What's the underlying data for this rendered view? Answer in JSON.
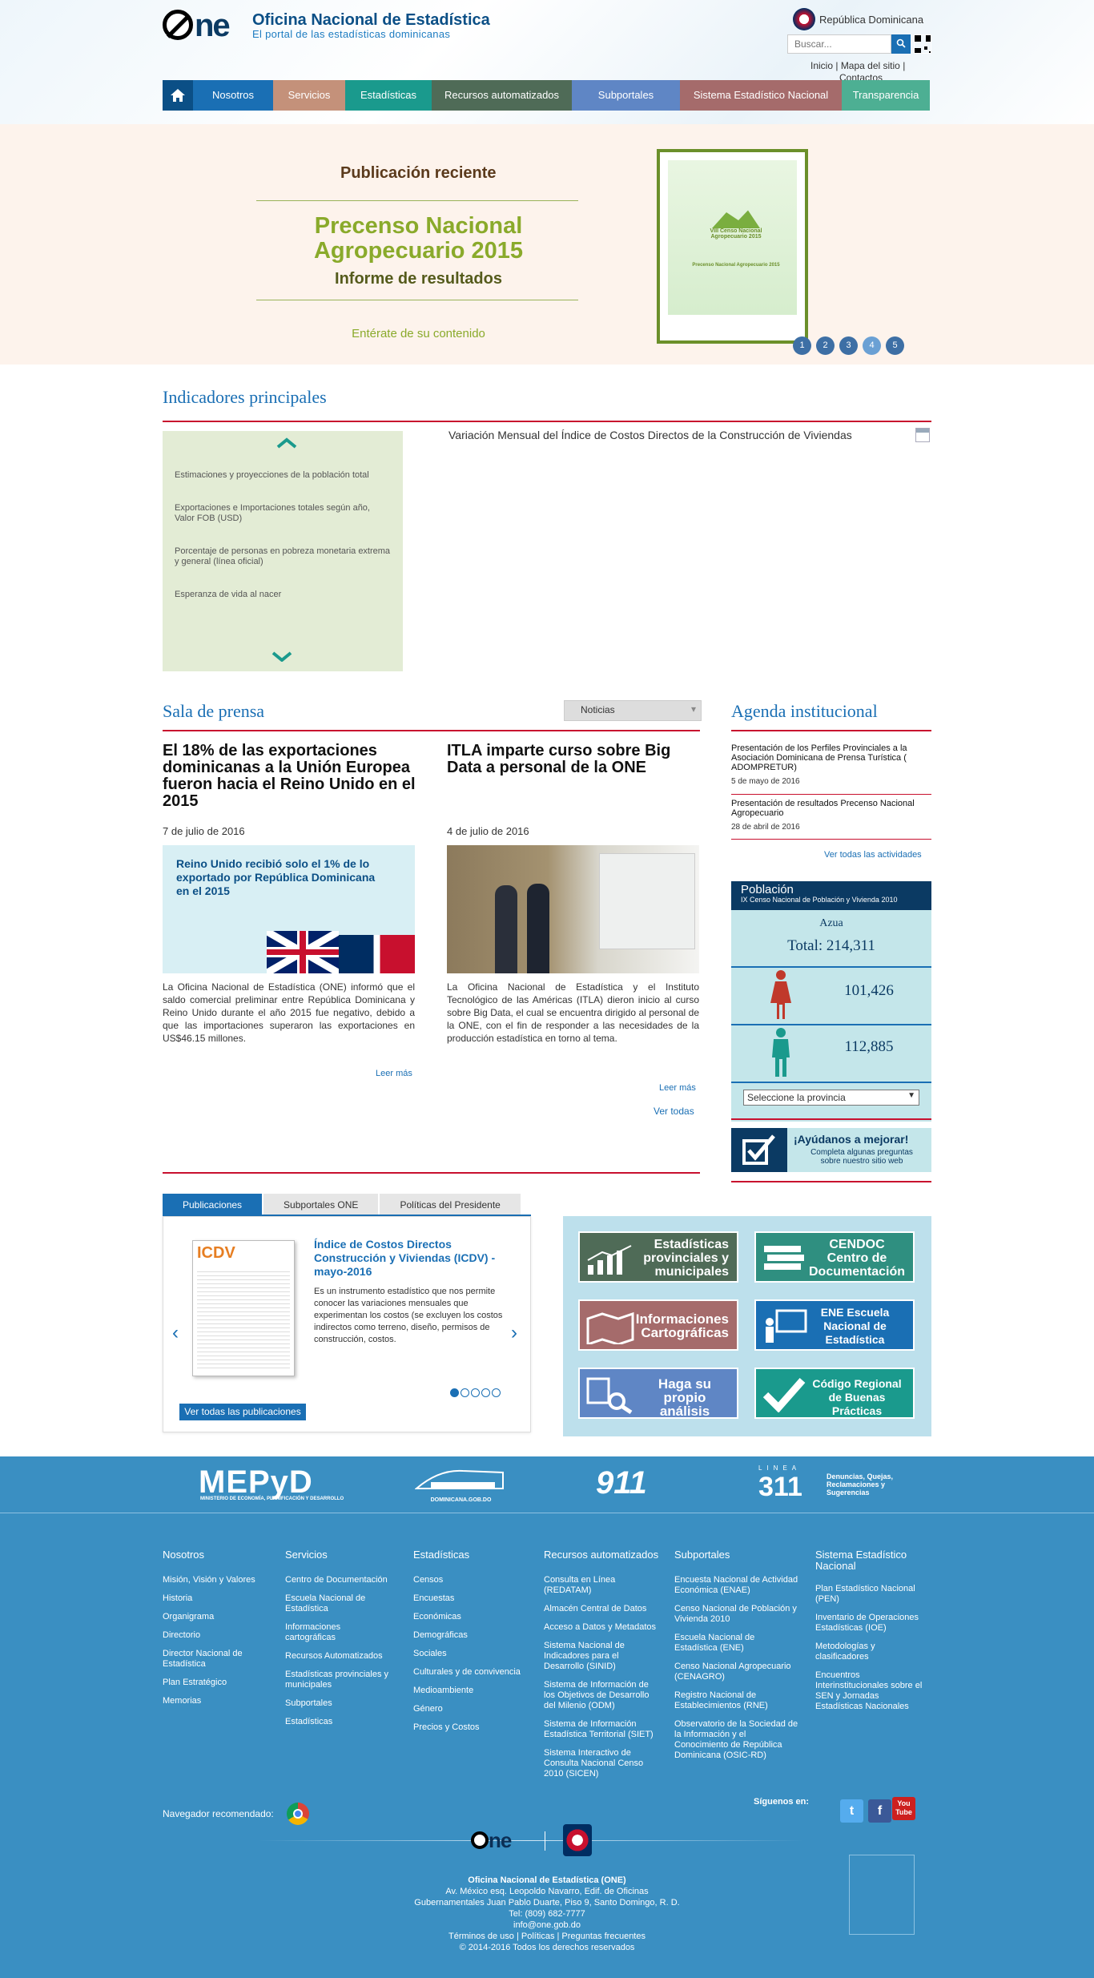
{
  "header": {
    "title": "Oficina Nacional de Estadística",
    "subtitle": "El portal de las estadísticas dominicanas",
    "logo_text": "ne",
    "country": "República Dominicana",
    "search_placeholder": "Buscar...",
    "top_links": [
      "Inicio",
      "Mapa del sitio",
      "Contactos"
    ]
  },
  "nav": {
    "items": [
      {
        "label": "Nosotros",
        "color": "#1a6fb4"
      },
      {
        "label": "Servicios",
        "color": "#c4917a"
      },
      {
        "label": "Estadísticas",
        "color": "#1a9a8d"
      },
      {
        "label": "Recursos automatizados",
        "color": "#4f6b57"
      },
      {
        "label": "Subportales",
        "color": "#5f86c5"
      },
      {
        "label": "Sistema Estadístico Nacional",
        "color": "#a56b6b"
      },
      {
        "label": "Transparencia",
        "color": "#4daf93"
      }
    ]
  },
  "banner": {
    "label": "Publicación reciente",
    "title": "Precenso Nacional Agropecuario 2015",
    "subtitle": "Informe de resultados",
    "cta": "Entérate de su contenido",
    "cover_title": "VIII Censo Nacional Agropecuario 2015",
    "cover_subtitle": "Precenso Nacional Agropecuario 2015",
    "slides": [
      "1",
      "2",
      "3",
      "4",
      "5"
    ]
  },
  "indicators": {
    "title": "Indicadores principales",
    "items": [
      "Estimaciones y proyecciones de la población total",
      "Exportaciones e Importaciones totales según año, Valor FOB (USD)",
      "Porcentaje de personas en pobreza monetaria extrema y general (línea oficial)",
      "Esperanza de vida al nacer"
    ],
    "chart_title": "Variación Mensual del Índice de Costos Directos de la Construcción de Viviendas"
  },
  "press": {
    "title": "Sala de prensa",
    "filter": "Noticias",
    "news": [
      {
        "title": "El 18% de las exportaciones dominicanas a la Unión Europea fueron hacia el Reino Unido en el 2015",
        "date": "7 de julio de 2016",
        "image_text": "Reino Unido recibió solo el 1% de lo exportado por República Dominicana en el 2015",
        "text": "La Oficina Nacional de Estadística (ONE) informó que el saldo comercial preliminar entre República Dominicana y Reino Unido durante el año 2015 fue negativo, debido a que las importaciones superaron las exportaciones en US$46.15 millones.",
        "more": "Leer más"
      },
      {
        "title": "ITLA imparte curso sobre Big Data a personal de la ONE",
        "date": "4 de julio de 2016",
        "text": "La Oficina Nacional de Estadística y el Instituto Tecnológico de las Américas (ITLA) dieron inicio al curso sobre Big Data, el cual se encuentra dirigido al personal de la ONE, con el fin de responder a las necesidades de la producción estadística en torno al tema.",
        "more": "Leer más"
      }
    ],
    "see_all": "Ver todas"
  },
  "agenda": {
    "title": "Agenda institucional",
    "items": [
      {
        "title": "Presentación de los Perfiles Provinciales a la Asociación Dominicana de Prensa Turística ( ADOMPRETUR)",
        "date": "5 de mayo de 2016"
      },
      {
        "title": "Presentación de resultados Precenso Nacional Agropecuario",
        "date": "28 de abril de 2016"
      }
    ],
    "see_all": "Ver todas las actividades"
  },
  "population": {
    "title": "Población",
    "subtitle": "IX Censo Nacional de Población y Vivienda 2010",
    "province": "Azua",
    "total": "Total: 214,311",
    "female": "101,426",
    "male": "112,885",
    "select": "Seleccione la provincia"
  },
  "help": {
    "title": "¡Ayúdanos a mejorar!",
    "text": "Completa algunas preguntas sobre nuestro sitio web"
  },
  "publications": {
    "tabs": [
      "Publicaciones",
      "Subportales ONE",
      "Políticas del Presidente"
    ],
    "item_title": "Índice de Costos Directos Construcción y Viviendas (ICDV) -mayo-2016",
    "item_text": "Es un instrumento estadístico que nos permite conocer las variaciones mensuales que experimentan los costos (se excluyen los costos indirectos como terreno, diseño, permisos de construcción, costos.",
    "cover_label": "ICDV",
    "see_all": "Ver todas las publicaciones",
    "prev": "‹",
    "next": "›"
  },
  "tiles": [
    {
      "label": "Estadísticas provinciales y municipales",
      "color": "#4f6b57"
    },
    {
      "label": "CENDOC Centro de Documentación",
      "color": "#2f8f80"
    },
    {
      "label": "Informaciones Cartográficas",
      "color": "#a56b6b"
    },
    {
      "label": "ENE Escuela Nacional de Estadística",
      "color": "#1a6fb4"
    },
    {
      "label": "Haga su propio análisis",
      "color": "#5f86c5"
    },
    {
      "label": "Código Regional de Buenas Prácticas",
      "color": "#1a9a8d"
    }
  ],
  "partners": {
    "mepyd": "MEPyD",
    "mepyd_sub": "MINISTERIO DE ECONOMÍA, PLANIFICACIÓN Y DESARROLLO",
    "gob": "DOMINICANA.GOB.DO",
    "n911": "911",
    "linea": "LINEA",
    "n311": "311",
    "n311_text": "Denuncias, Quejas, Reclamaciones y Sugerencias"
  },
  "footer": {
    "columns": [
      {
        "title": "Nosotros",
        "items": [
          "Misión, Visión y Valores",
          "Historia",
          "Organigrama",
          "Directorio",
          "Director Nacional de Estadística",
          "Plan Estratégico",
          "Memorias"
        ]
      },
      {
        "title": "Servicios",
        "items": [
          "Centro de Documentación",
          "Escuela Nacional de Estadística",
          "Informaciones cartográficas",
          "Recursos Automatizados",
          "Estadísticas provinciales y municipales",
          "Subportales",
          "Estadísticas"
        ]
      },
      {
        "title": "Estadísticas",
        "items": [
          "Censos",
          "Encuestas",
          "Económicas",
          "Demográficas",
          "Sociales",
          "Culturales y de convivencia",
          "Medioambiente",
          "Género",
          "Precios y Costos"
        ]
      },
      {
        "title": "Recursos automatizados",
        "items": [
          "Consulta en Línea (REDATAM)",
          "Almacén Central de Datos",
          "Acceso a Datos y Metadatos",
          "Sistema Nacional de Indicadores para el Desarrollo (SINID)",
          "Sistema de Información de los Objetivos de Desarrollo del Milenio (ODM)",
          "Sistema de Información Estadística Territorial (SIET)",
          "Sistema Interactivo de Consulta Nacional Censo 2010 (SICEN)"
        ]
      },
      {
        "title": "Subportales",
        "items": [
          "Encuesta Nacional de Actividad Económica (ENAE)",
          "Censo Nacional de Población y Vivienda 2010",
          "Escuela Nacional de Estadística (ENE)",
          "Censo Nacional Agropecuario (CENAGRO)",
          "Registro Nacional de Establecimientos (RNE)",
          "Observatorio de la Sociedad de la Información y el Conocimiento de República Dominicana (OSIC-RD)"
        ]
      },
      {
        "title": "Sistema Estadístico Nacional",
        "items": [
          "Plan Estadístico Nacional (PEN)",
          "Inventario de Operaciones Estadísticas (IOE)",
          "Metodologías y clasificadores",
          "Encuentros Interinstitucionales sobre el SEN y Jornadas Estadísticas Nacionales"
        ]
      }
    ],
    "browser_label": "Navegador recomendado:",
    "follow_label": "Síguenos en:",
    "social": [
      "t",
      "f",
      "You Tube"
    ],
    "address": [
      "Oficina Nacional de Estadística (ONE)",
      "Av. México esq. Leopoldo Navarro, Edif. de Oficinas",
      "Gubernamentales Juan Pablo Duarte, Piso 9, Santo Domingo, R. D.",
      "Tel: (809) 682-7777",
      "info@one.gob.do",
      "Términos de uso | Políticas | Preguntas frecuentes",
      "© 2014-2016 Todos los derechos reservados"
    ]
  }
}
